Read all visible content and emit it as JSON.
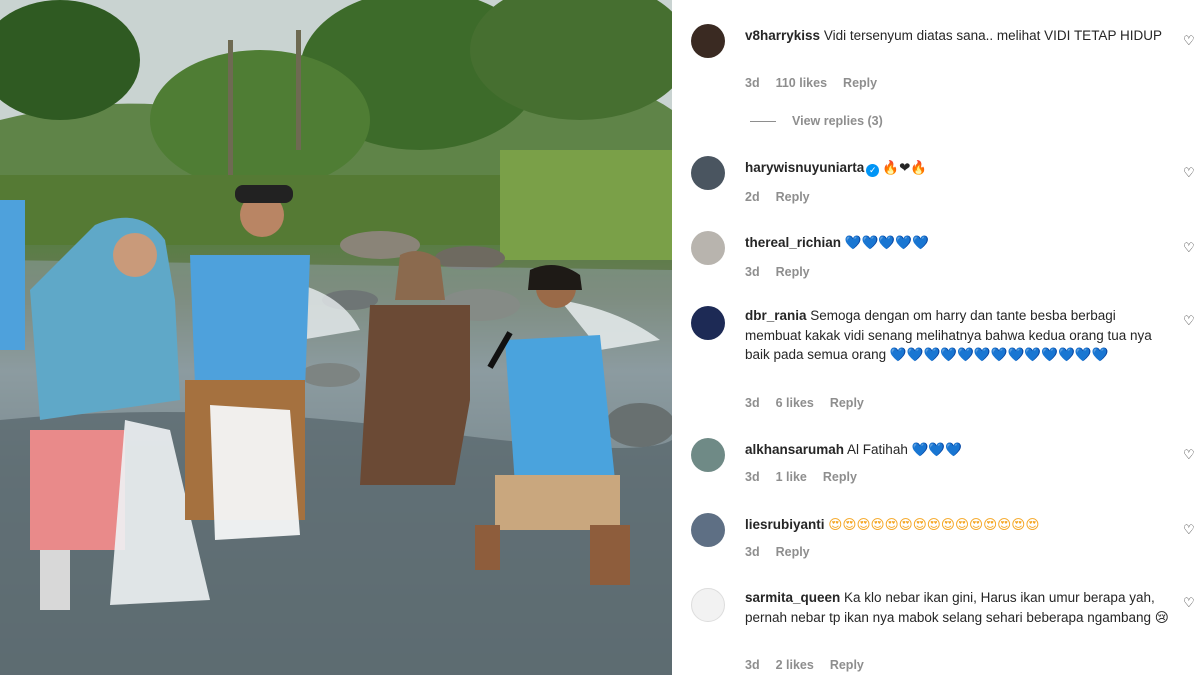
{
  "comments": [
    {
      "username": "v8harrykiss",
      "text": " Vidi tersenyum diatas sana.. melihat VIDI TETAP HIDUP",
      "time": "3d",
      "likes": "110 likes",
      "reply": "Reply",
      "avatar_color": "#3a2a22",
      "view_replies": "View replies (3)"
    },
    {
      "username": "harywisnuyuniarta",
      "text": "🔥❤🔥",
      "time": "2d",
      "reply": "Reply",
      "avatar_color": "#4a5560",
      "verified": true
    },
    {
      "username": "thereal_richian",
      "text": "💙💙💙💙💙",
      "time": "3d",
      "reply": "Reply",
      "avatar_color": "#b8b4ae"
    },
    {
      "username": "dbr_rania",
      "text": " Semoga dengan om harry dan tante besba berbagi membuat kakak vidi senang melihatnya bahwa kedua orang tua nya baik pada semua orang 💙💙💙💙💙💙💙💙💙💙💙💙💙",
      "time": "3d",
      "likes": "6 likes",
      "reply": "Reply",
      "avatar_color": "#1d2a55"
    },
    {
      "username": "alkhansarumah",
      "text": " Al Fatihah 💙💙💙",
      "time": "3d",
      "likes": "1 like",
      "reply": "Reply",
      "avatar_color": "#6f8a86"
    },
    {
      "username": "liesrubiyanti",
      "text": "😍😍😍😍😍😍😍😍😍😍😍😍😍😍😍",
      "time": "3d",
      "reply": "Reply",
      "avatar_color": "#5e6f84"
    },
    {
      "username": "sarmita_queen",
      "text": " Ka klo nebar ikan gini, Harus ikan umur berapa yah, pernah nebar tp ikan nya mabok selang sehari beberapa ngambang 😢",
      "time": "3d",
      "likes": "2 likes",
      "reply": "Reply",
      "avatar_color": "#f2f2f2"
    }
  ]
}
